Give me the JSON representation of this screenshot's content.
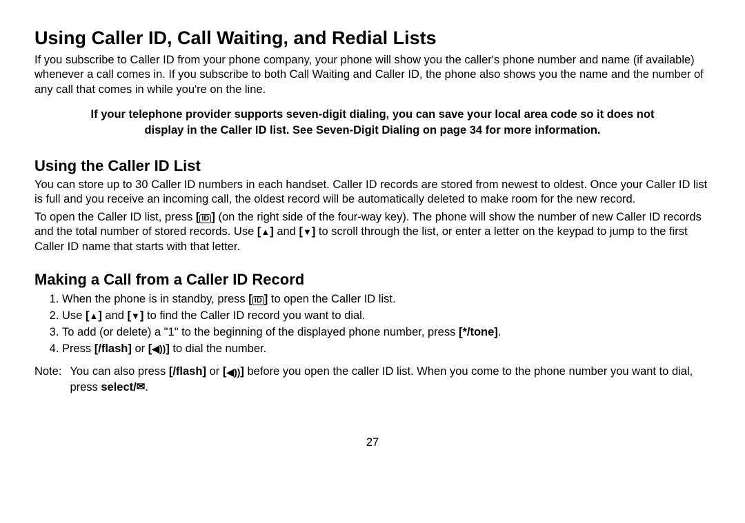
{
  "page": {
    "title": "Using Caller ID, Call Waiting, and Redial Lists",
    "intro": "If you subscribe to Caller ID from your phone company, your phone will show you the caller's phone number and name (if available) whenever a call comes in. If you subscribe to both Call Waiting and Caller ID, the phone also shows you the name and the number of any call that comes in while you're on the line.",
    "note": "If your telephone provider supports seven-digit dialing, you can save your local area code so it does not display in the Caller ID list. See Seven-Digit Dialing on page 34 for more information.",
    "section1": {
      "title": "Using the Caller ID List",
      "para1": "You can store up to 30 Caller ID numbers in each handset. Caller ID records are stored from newest to oldest. Once your Caller ID list is full and you receive an incoming call, the oldest record will be automatically deleted to make room for the new record.",
      "para2a": "To open the Caller ID list, press ",
      "para2b": " (on the right side of the four-way key). The phone will show the number of new Caller ID records and the total number of stored records. Use ",
      "para2c": " and ",
      "para2d": "  to scroll through the list, or enter a letter on the keypad to jump to the first Caller ID name that starts with that letter."
    },
    "section2": {
      "title": "Making a Call from a Caller ID Record",
      "step1a": "When the phone is in standby, press ",
      "step1b": " to open the Caller ID list.",
      "step2a": "Use ",
      "step2b": " and ",
      "step2c": " to find the Caller ID record you want to dial.",
      "step3a": "To add (or delete) a \"1\" to the beginning of the displayed phone number, press ",
      "step3b": ".",
      "step4a": "Press ",
      "step4b": " or ",
      "step4c": " to dial the number."
    },
    "footnote": {
      "label": "Note:",
      "text1": "You can also press ",
      "text2": " or ",
      "text3": " before you open the caller ID list. When you come to the phone number you want to dial, press ",
      "text4": "."
    },
    "keys": {
      "id": "ID",
      "up": "▲",
      "down": "▼",
      "tone": "*/tone",
      "flash": "/flash",
      "speaker": "◀))",
      "select": "select/",
      "envelope": "✉"
    },
    "pagenum": "27"
  }
}
